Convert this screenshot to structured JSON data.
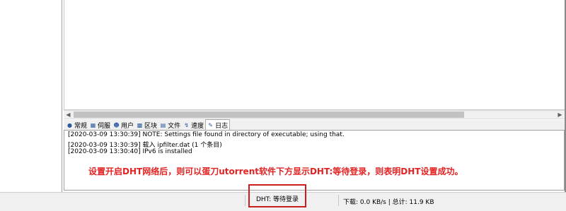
{
  "tabs": [
    {
      "icon": "info-icon",
      "label": "常规"
    },
    {
      "icon": "server-icon",
      "label": "伺服"
    },
    {
      "icon": "users-icon",
      "label": "用户"
    },
    {
      "icon": "blocks-icon",
      "label": "区块"
    },
    {
      "icon": "files-icon",
      "label": "文件"
    },
    {
      "icon": "speed-icon",
      "label": "速度"
    },
    {
      "icon": "log-icon",
      "label": "日志"
    }
  ],
  "active_tab": "日志",
  "log": [
    "[2020-03-09 13:30:39]  NOTE: Settings file found in directory of executable; using that.",
    "[2020-03-09 13:30:39]  载入 ipfilter.dat (1 个条目)",
    "[2020-03-09 13:30:40]  IPv6 is installed"
  ],
  "annotation": "设置开启DHT网络后，则可以蛋刀utorrent软件下方显示DHT:等待登录，则表明DHT设置成功。",
  "status": {
    "dht": "DHT: 等待登录",
    "speed": "下载: 0.0 KB/s | 总计: 11.9 KB"
  },
  "colors": {
    "annotation": "#e32222",
    "highlight_box": "#c81e1e"
  }
}
